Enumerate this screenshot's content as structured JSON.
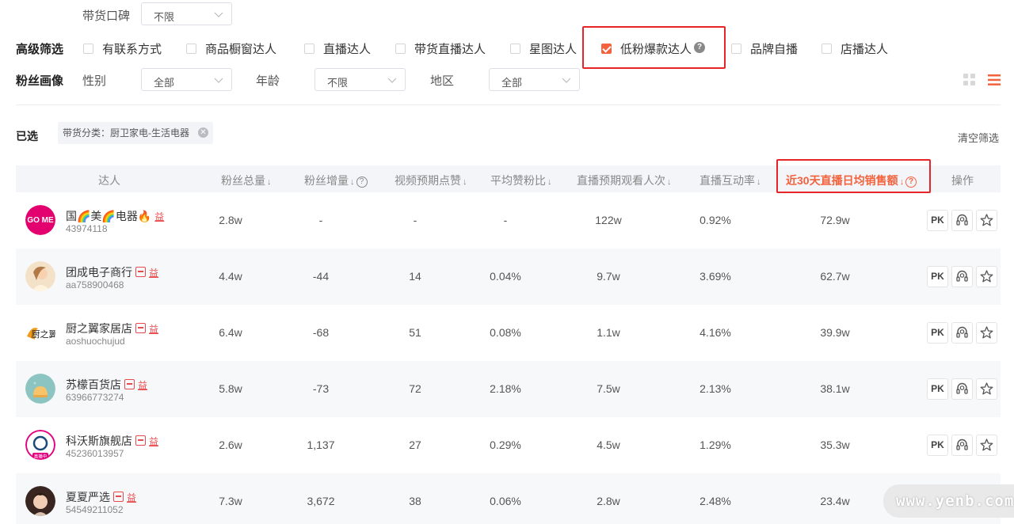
{
  "filters": {
    "reputation": {
      "label": "带货口碑",
      "value": "不限"
    },
    "advanced": {
      "title": "高级筛选",
      "options": [
        {
          "label": "有联系方式",
          "checked": false
        },
        {
          "label": "商品橱窗达人",
          "checked": false
        },
        {
          "label": "直播达人",
          "checked": false
        },
        {
          "label": "带货直播达人",
          "checked": false
        },
        {
          "label": "星图达人",
          "checked": false
        },
        {
          "label": "低粉爆款达人",
          "checked": true
        },
        {
          "label": "品牌自播",
          "checked": false
        },
        {
          "label": "店播达人",
          "checked": false
        }
      ]
    },
    "fans_profile": {
      "title": "粉丝画像",
      "gender": {
        "label": "性别",
        "value": "全部"
      },
      "age": {
        "label": "年龄",
        "value": "不限"
      },
      "region": {
        "label": "地区",
        "value": "全部"
      }
    }
  },
  "selected": {
    "label": "已选",
    "tag": "带货分类：厨卫家电-生活电器",
    "clear_label": "清空筛选"
  },
  "table": {
    "headers": {
      "creator": "达人",
      "fans_total": "粉丝总量",
      "fans_growth": "粉丝增量",
      "video_likes": "视频预期点赞",
      "like_fan_ratio": "平均赞粉比",
      "live_views": "直播预期观看人次",
      "live_interaction": "直播互动率",
      "daily_sales": "近30天直播日均销售额",
      "actions": "操作"
    },
    "rows": [
      {
        "name": "国🌈美🌈电器🔥",
        "id": "43974118",
        "fans_total": "2.8w",
        "fans_growth": "-",
        "video_likes": "-",
        "like_fan_ratio": "-",
        "live_views": "122w",
        "live_interaction": "0.92%",
        "daily_sales": "72.9w",
        "avatar": "gome"
      },
      {
        "name": "团成电子商行",
        "id": "aa758900468",
        "fans_total": "4.4w",
        "fans_growth": "-44",
        "video_likes": "14",
        "like_fan_ratio": "0.04%",
        "live_views": "9.7w",
        "live_interaction": "3.69%",
        "daily_sales": "62.7w",
        "avatar": "girl"
      },
      {
        "name": "厨之翼家居店",
        "id": "aoshuochujud",
        "fans_total": "6.4w",
        "fans_growth": "-68",
        "video_likes": "51",
        "like_fan_ratio": "0.08%",
        "live_views": "1.1w",
        "live_interaction": "4.16%",
        "daily_sales": "39.9w",
        "avatar": "wing"
      },
      {
        "name": "苏檬百货店",
        "id": "63966773274",
        "fans_total": "5.8w",
        "fans_growth": "-73",
        "video_likes": "72",
        "like_fan_ratio": "2.18%",
        "live_views": "7.5w",
        "live_interaction": "2.13%",
        "daily_sales": "38.1w",
        "avatar": "lamp"
      },
      {
        "name": "科沃斯旗舰店",
        "id": "45236013957",
        "fans_total": "2.6w",
        "fans_growth": "1,137",
        "video_likes": "27",
        "like_fan_ratio": "0.29%",
        "live_views": "4.5w",
        "live_interaction": "1.29%",
        "daily_sales": "35.3w",
        "avatar": "ecovacs",
        "live_badge": "直播中"
      },
      {
        "name": "夏夏严选",
        "id": "54549211052",
        "fans_total": "7.3w",
        "fans_growth": "3,672",
        "video_likes": "38",
        "like_fan_ratio": "0.06%",
        "live_views": "2.8w",
        "live_interaction": "2.48%",
        "daily_sales": "23.4w",
        "avatar": "portrait"
      }
    ],
    "pk_label": "PK"
  },
  "gome_logo": "GO ME",
  "watermark": "www.yenb.com",
  "colors": {
    "accent": "#f3623d",
    "highlight_box": "#e8242b"
  }
}
